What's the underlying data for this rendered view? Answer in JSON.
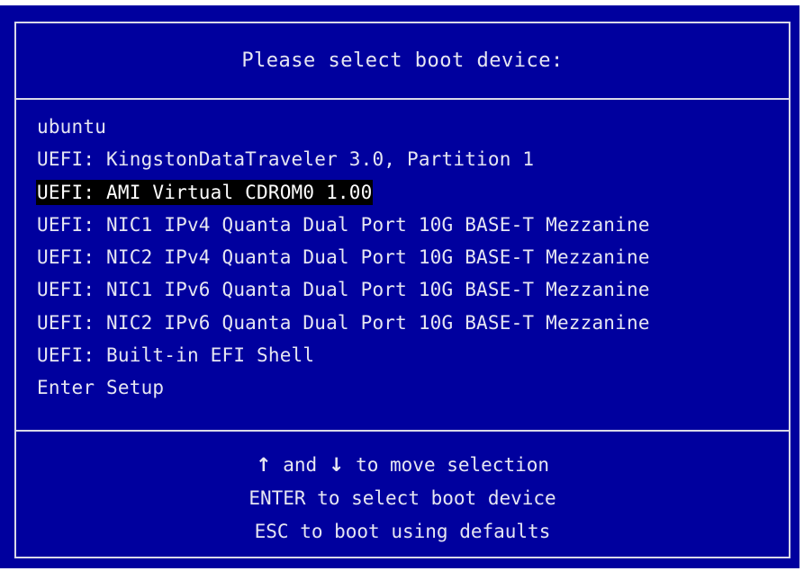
{
  "header": {
    "title": "Please select boot device:"
  },
  "boot_menu": {
    "selected_index": 2,
    "items": [
      {
        "label": "ubuntu"
      },
      {
        "label": "UEFI: KingstonDataTraveler 3.0, Partition 1"
      },
      {
        "label": "UEFI: AMI Virtual CDROM0 1.00"
      },
      {
        "label": "UEFI: NIC1 IPv4 Quanta Dual Port 10G BASE-T Mezzanine"
      },
      {
        "label": "UEFI: NIC2 IPv4 Quanta Dual Port 10G BASE-T Mezzanine"
      },
      {
        "label": "UEFI: NIC1 IPv6 Quanta Dual Port 10G BASE-T Mezzanine"
      },
      {
        "label": "UEFI: NIC2 IPv6 Quanta Dual Port 10G BASE-T Mezzanine"
      },
      {
        "label": "UEFI: Built-in EFI Shell"
      },
      {
        "label": "Enter Setup"
      }
    ]
  },
  "help": {
    "up_arrow": "↑",
    "and_text": "and",
    "down_arrow": "↓",
    "move_text": "to move selection",
    "enter_text": "ENTER to select boot device",
    "esc_text": "ESC to boot using defaults"
  },
  "colors": {
    "background": "#00009e",
    "text": "#e6e6f2",
    "selection_bg": "#000000",
    "border": "#d8d8e8"
  }
}
